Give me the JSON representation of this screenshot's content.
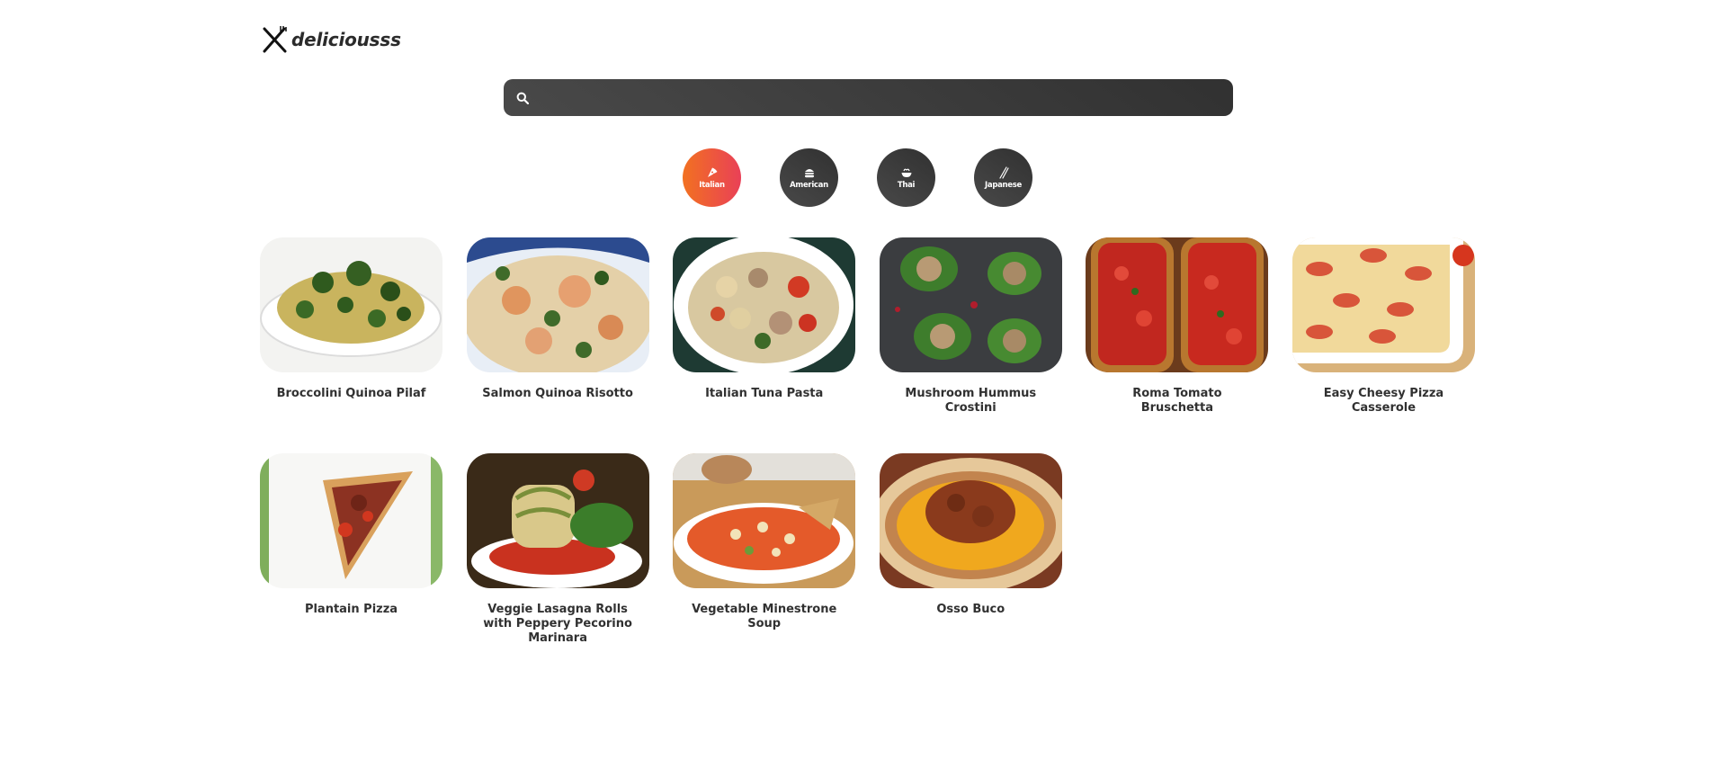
{
  "brand": {
    "name": "deliciousss",
    "icon": "fork-knife-icon"
  },
  "search": {
    "placeholder": "",
    "value": "",
    "icon": "search-icon"
  },
  "categories": [
    {
      "label": "Italian",
      "icon": "pizza-icon",
      "active": true
    },
    {
      "label": "American",
      "icon": "hamburger-icon",
      "active": false
    },
    {
      "label": "Thai",
      "icon": "bowl-icon",
      "active": false
    },
    {
      "label": "Japanese",
      "icon": "chopsticks-icon",
      "active": false
    }
  ],
  "colors": {
    "accent_from": "#f27121",
    "accent_to": "#e94057",
    "dark_from": "#494949",
    "dark_to": "#313131"
  },
  "recipes": [
    {
      "title": "Broccolini Quinoa Pilaf"
    },
    {
      "title": "Salmon Quinoa Risotto"
    },
    {
      "title": "Italian Tuna Pasta"
    },
    {
      "title": "Mushroom Hummus Crostini"
    },
    {
      "title": "Roma Tomato Bruschetta"
    },
    {
      "title": "Easy Cheesy Pizza Casserole"
    },
    {
      "title": "Plantain Pizza"
    },
    {
      "title": "Veggie Lasagna Rolls with Peppery Pecorino Marinara"
    },
    {
      "title": "Vegetable Minestrone Soup"
    },
    {
      "title": "Osso Buco"
    }
  ]
}
